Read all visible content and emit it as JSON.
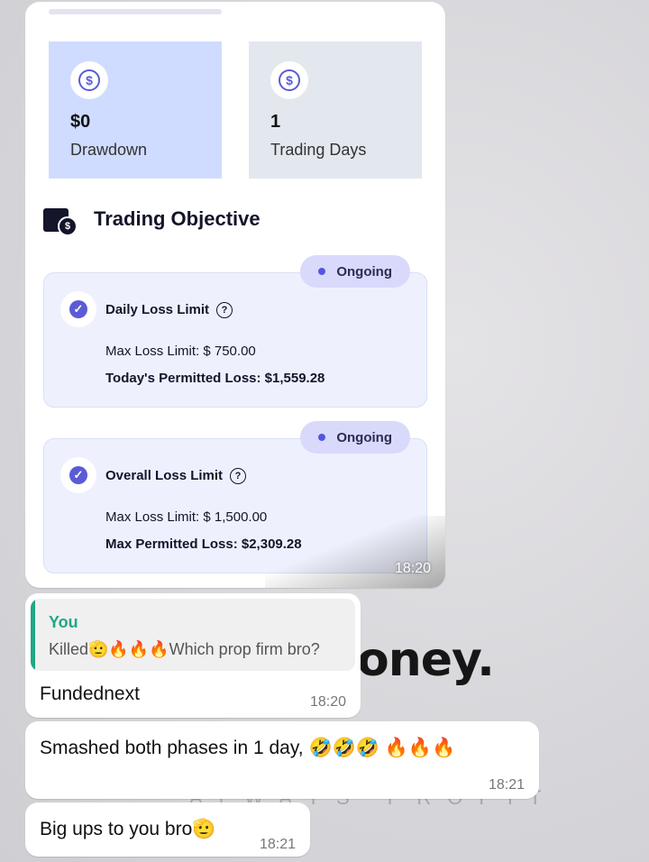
{
  "wallpaper": {
    "logo_text": "oney.",
    "sub_text": "ALWAYS PROFIT"
  },
  "image_message": {
    "stats": [
      {
        "value": "$0",
        "label": "Drawdown"
      },
      {
        "value": "1",
        "label": "Trading Days"
      }
    ],
    "section_title": "Trading Objective",
    "objectives": [
      {
        "status": "Ongoing",
        "title": "Daily Loss Limit",
        "line1": "Max Loss Limit: $ 750.00",
        "line2": "Today's Permitted Loss: $1,559.28"
      },
      {
        "status": "Ongoing",
        "title": "Overall Loss Limit",
        "line1": "Max Loss Limit: $ 1,500.00",
        "line2": "Max Permitted Loss: $2,309.28"
      }
    ],
    "time": "18:20"
  },
  "reply_message": {
    "quoted_author": "You",
    "quoted_text": "Killed🫡🔥🔥🔥Which prop firm bro?",
    "text": "Fundednext",
    "time": "18:20"
  },
  "message_2": {
    "text": "Smashed both phases in 1 day, 🤣🤣🤣 🔥🔥🔥",
    "time": "18:21"
  },
  "message_3": {
    "text": "Big ups to you bro🫡",
    "time": "18:21"
  }
}
